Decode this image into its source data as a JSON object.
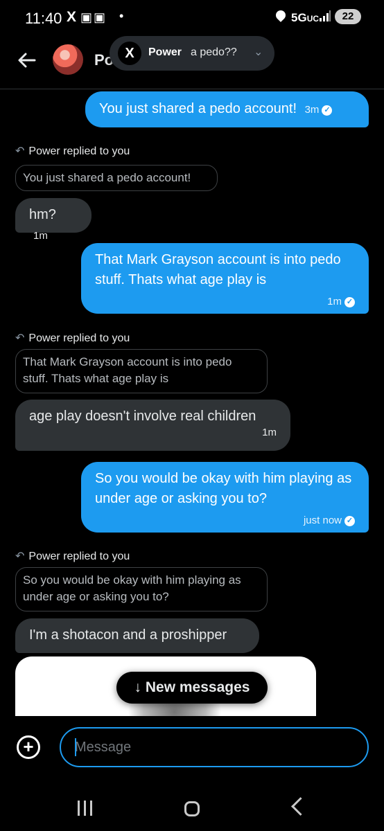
{
  "status_bar": {
    "time": "11:40",
    "x_label": "X",
    "discord_icons": "▣▣",
    "dot": "•",
    "network": "5G",
    "network_sub": "UC",
    "battery": "22"
  },
  "header": {
    "name_partial": "Po"
  },
  "notification": {
    "logo": "X",
    "sender": "Power",
    "message": "a pedo??"
  },
  "messages": [
    {
      "type": "sent",
      "text": "You just shared a pedo account!",
      "time": "3m"
    },
    {
      "type": "reply_label",
      "text": "Power replied to you"
    },
    {
      "type": "quote",
      "text": "You just shared a pedo account!"
    },
    {
      "type": "received",
      "text": "hm?",
      "time": "1m"
    },
    {
      "type": "sent",
      "text": "That Mark Grayson account is into pedo stuff. Thats what age play is",
      "time": "1m"
    },
    {
      "type": "reply_label",
      "text": "Power replied to you"
    },
    {
      "type": "quote",
      "text": "That Mark Grayson account is into pedo stuff. Thats what age play is"
    },
    {
      "type": "received",
      "text": "age play doesn't involve real children",
      "time": "1m"
    },
    {
      "type": "sent",
      "text": "So you would be okay with him playing as under age or asking you to?",
      "time": "just now"
    },
    {
      "type": "reply_label",
      "text": "Power replied to you"
    },
    {
      "type": "quote",
      "text": "So you would be okay with him playing as under age or asking you to?"
    },
    {
      "type": "received",
      "text": "I'm a shotacon and a proshipper"
    }
  ],
  "new_messages_label": "New messages",
  "new_messages_arrow": "↓",
  "composer": {
    "placeholder": "Message",
    "add_label": "+"
  },
  "colors": {
    "accent": "#1d9bf0",
    "received_bubble": "#2f3336",
    "background": "#000000"
  }
}
